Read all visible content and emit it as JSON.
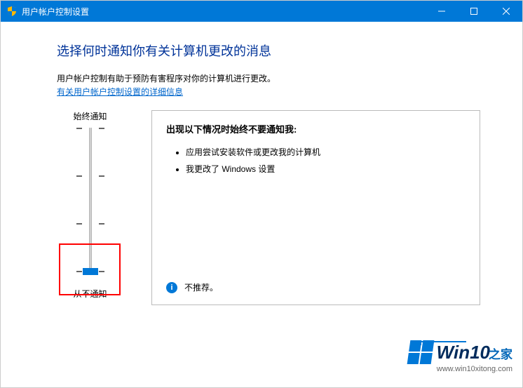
{
  "titlebar": {
    "title": "用户帐户控制设置"
  },
  "heading": "选择何时通知你有关计算机更改的消息",
  "description": "用户帐户控制有助于预防有害程序对你的计算机进行更改。",
  "link_text": "有关用户帐户控制设置的详细信息",
  "slider": {
    "top_label": "始终通知",
    "bottom_label": "从不通知"
  },
  "panel": {
    "title": "出现以下情况时始终不要通知我:",
    "items": [
      "应用尝试安装软件或更改我的计算机",
      "我更改了 Windows 设置"
    ],
    "footer_text": "不推荐。"
  },
  "watermark": {
    "brand_main": "Win10",
    "brand_suffix": "之家",
    "url": "www.win10xitong.com"
  }
}
